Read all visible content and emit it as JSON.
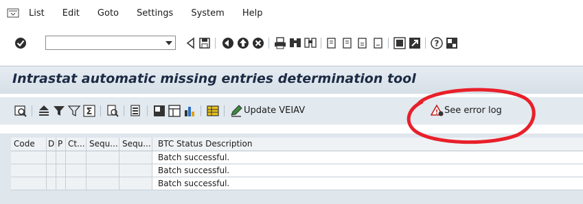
{
  "menubar": {
    "items": [
      {
        "label": "List"
      },
      {
        "label": "Edit"
      },
      {
        "label": "Goto"
      },
      {
        "label": "Settings"
      },
      {
        "label": "System"
      },
      {
        "label": "Help"
      }
    ]
  },
  "toolbar": {
    "command_value": "",
    "icons": [
      "enter-icon",
      "back-arrow-icon",
      "save-icon",
      "green-back-icon",
      "exit-icon",
      "cancel-icon",
      "print-icon",
      "find-icon",
      "find-next-icon",
      "first-page-icon",
      "previous-page-icon",
      "next-page-icon",
      "last-page-icon",
      "new-session-icon",
      "shortcut-icon",
      "help-icon",
      "customize-layout-icon"
    ]
  },
  "title": "Intrastat automatic missing entries determination tool",
  "app_toolbar": {
    "update_label": "Update VEIAV",
    "error_log_label": "See error log"
  },
  "table": {
    "columns": [
      "Code",
      "D",
      "P",
      "Ct...",
      "Sequ...",
      "Sequ...",
      "BTC Status Description"
    ],
    "rows": [
      {
        "desc": "Batch successful."
      },
      {
        "desc": "Batch successful."
      },
      {
        "desc": "Batch successful."
      }
    ]
  },
  "annotation": {
    "color": "#e8202a",
    "shape": "ellipse-highlight"
  }
}
